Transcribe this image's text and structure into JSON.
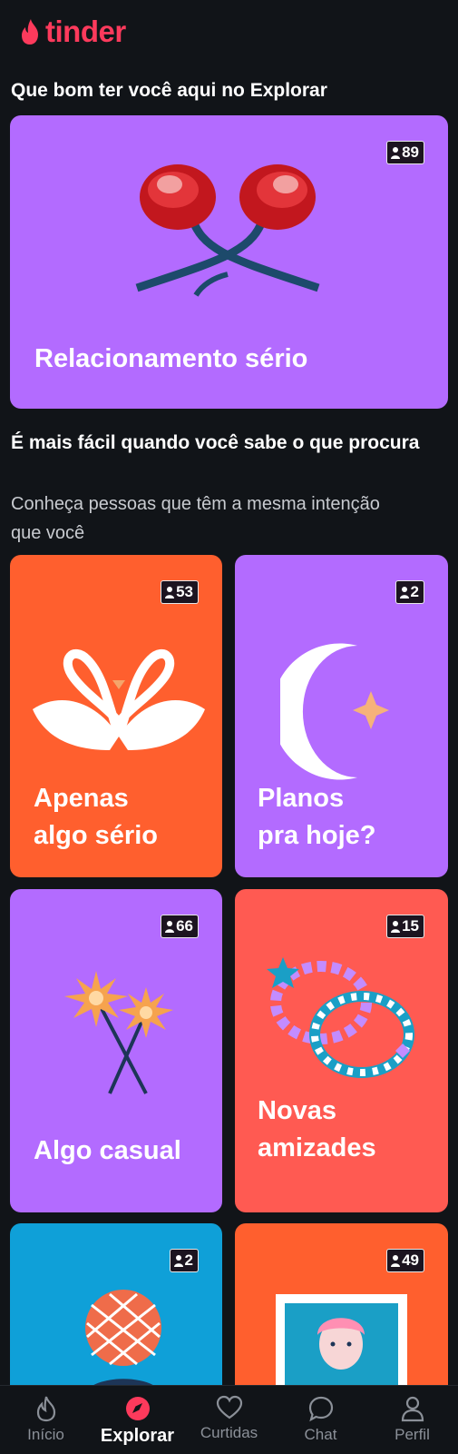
{
  "app": {
    "brand": "tinder"
  },
  "explore": {
    "welcome_title": "Que bom ter você aqui no Explorar",
    "featured": {
      "title": "Relacionamento sério",
      "count": "89"
    },
    "intent_section": {
      "title": "É mais fácil quando você sabe o que procura",
      "subtitle": "Conheça pessoas que têm a mesma intenção que você"
    },
    "cards": [
      {
        "title": "Apenas\nalgo sério",
        "count": "53",
        "color": "#ff5f2e"
      },
      {
        "title": "Planos\npra hoje?",
        "count": "2",
        "color": "#b36bff"
      },
      {
        "title": "Algo casual",
        "count": "66",
        "color": "#b36bff"
      },
      {
        "title": "Novas\namizades",
        "count": "15",
        "color": "#ff5a52"
      },
      {
        "title": "",
        "count": "2",
        "color": "#0fa0d8"
      },
      {
        "title": "",
        "count": "49",
        "color": "#ff5f2e"
      }
    ]
  },
  "nav": {
    "items": [
      {
        "label": "Início",
        "icon": "flame-icon"
      },
      {
        "label": "Explorar",
        "icon": "compass-icon",
        "active": true
      },
      {
        "label": "Curtidas",
        "icon": "heart-icon"
      },
      {
        "label": "Chat",
        "icon": "chat-bubble-icon"
      },
      {
        "label": "Perfil",
        "icon": "person-icon"
      }
    ]
  }
}
